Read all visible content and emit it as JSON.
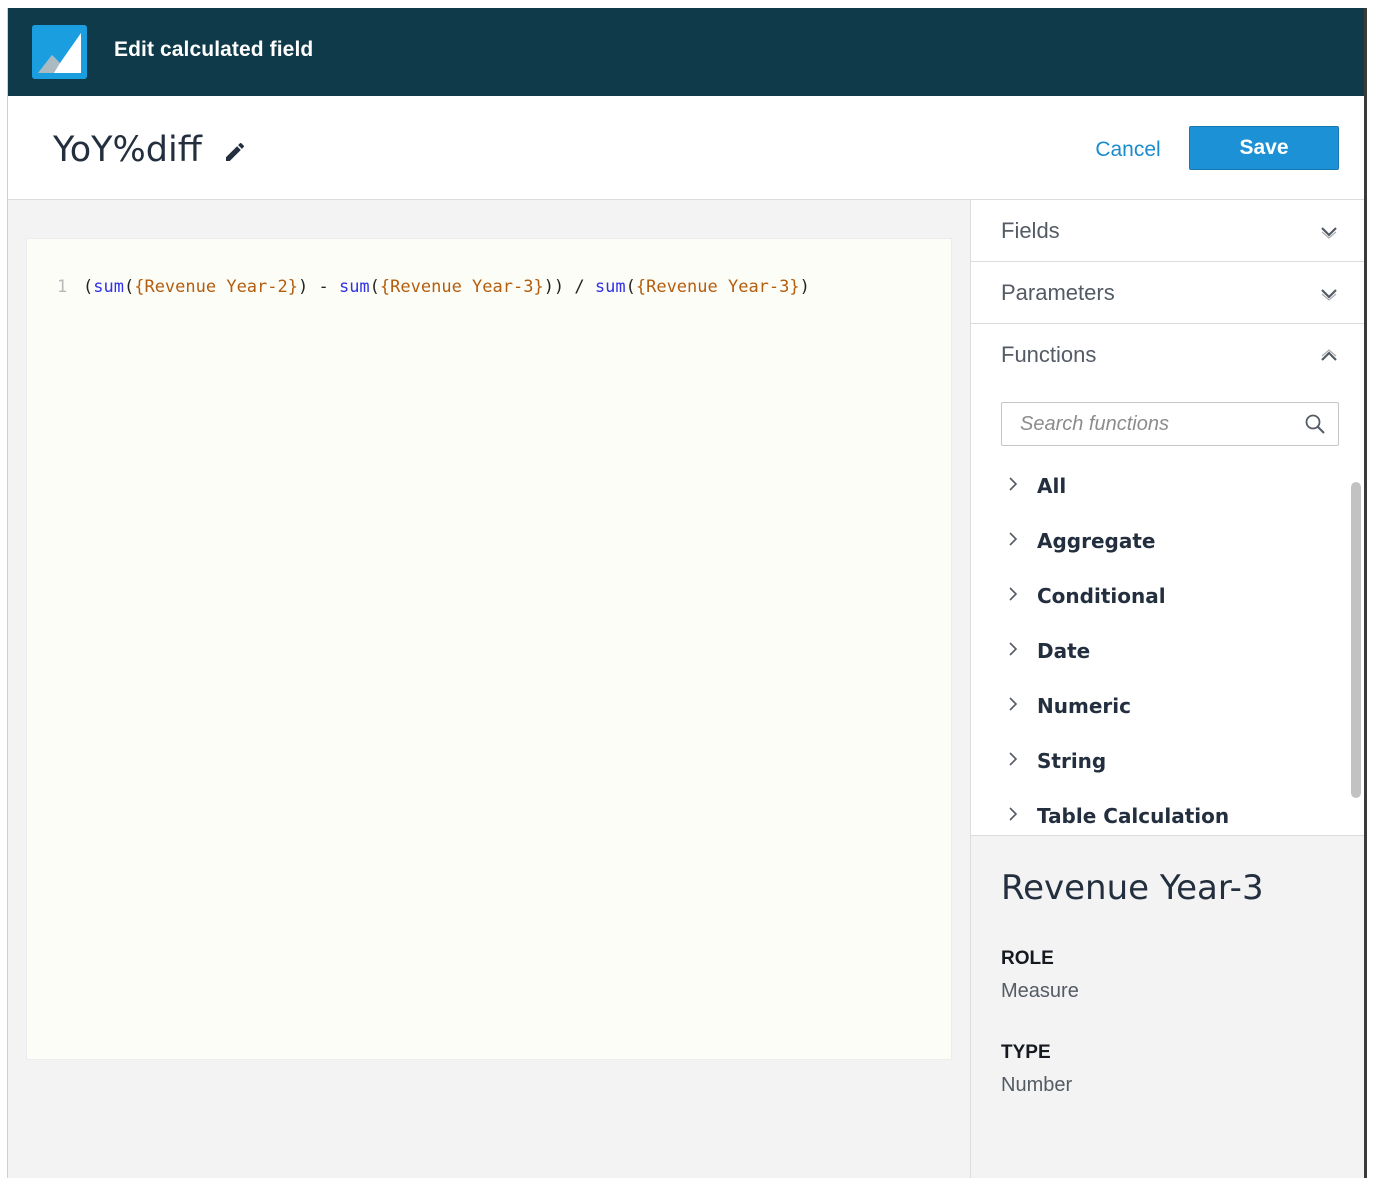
{
  "topbar": {
    "title": "Edit calculated field",
    "logo_icon": "quicksight-logo-icon"
  },
  "header": {
    "field_name": "YoY%diff",
    "cancel_label": "Cancel",
    "save_label": "Save"
  },
  "editor": {
    "line_number": "1",
    "tokens": {
      "t1": "(",
      "t2": "sum",
      "t3": "(",
      "t4": "{Revenue Year-2}",
      "t5": ")",
      "t6": " - ",
      "t7": "sum",
      "t8": "(",
      "t9": "{Revenue Year-3}",
      "t10": "))",
      "t11": " / ",
      "t12": "sum",
      "t13": "(",
      "t14": "{Revenue Year-3}",
      "t15": ")"
    }
  },
  "sidebar": {
    "fields_label": "Fields",
    "parameters_label": "Parameters",
    "functions_label": "Functions",
    "search_placeholder": "Search functions",
    "categories": [
      "All",
      "Aggregate",
      "Conditional",
      "Date",
      "Numeric",
      "String",
      "Table Calculation"
    ]
  },
  "detail": {
    "title": "Revenue Year-3",
    "role_label": "ROLE",
    "role_value": "Measure",
    "type_label": "TYPE",
    "type_value": "Number"
  },
  "colors": {
    "topbar": "#0f3a4a",
    "accent": "#1d91d6",
    "keyword": "#3131e6",
    "field_ref": "#b35d0f"
  }
}
